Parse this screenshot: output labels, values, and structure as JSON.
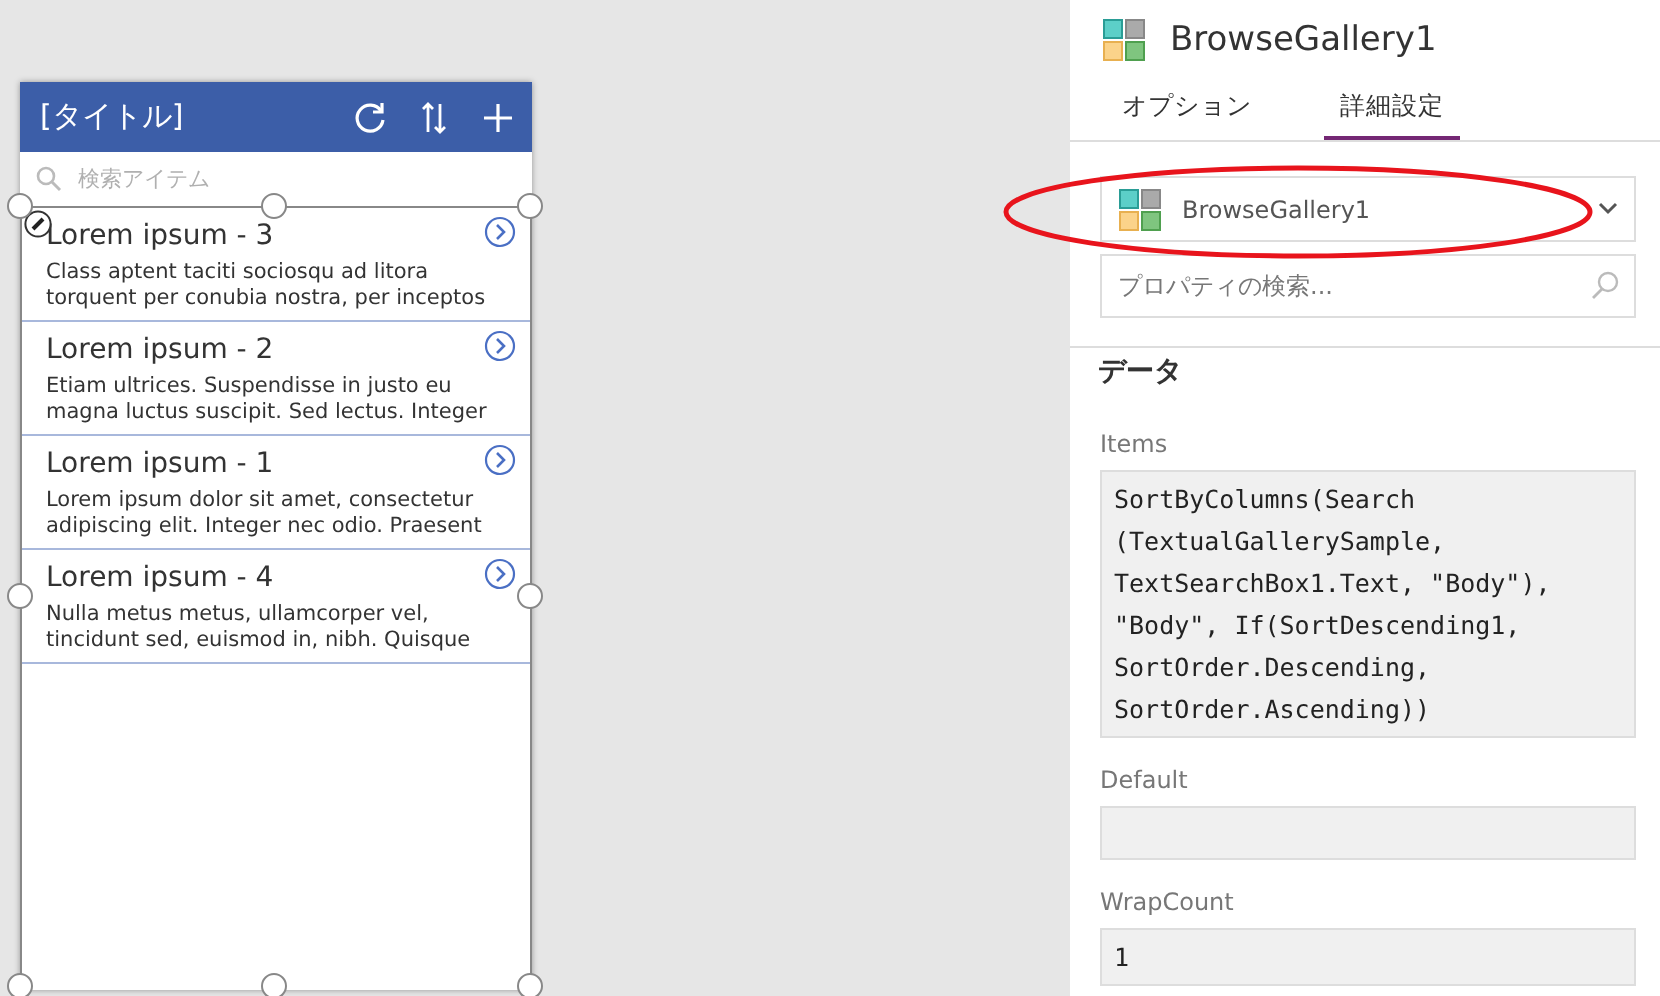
{
  "app_screen": {
    "title": "[タイトル]",
    "search": {
      "placeholder": "検索アイテム"
    },
    "items": [
      {
        "title": "Lorem ipsum - 3",
        "body": [
          "Class aptent taciti sociosqu ad litora",
          "torquent per conubia nostra, per inceptos"
        ]
      },
      {
        "title": "Lorem ipsum - 2",
        "body": [
          "Etiam ultrices. Suspendisse in justo eu",
          "magna luctus suscipit. Sed lectus. Integer"
        ]
      },
      {
        "title": "Lorem ipsum - 1",
        "body": [
          "Lorem ipsum dolor sit amet, consectetur",
          "adipiscing elit. Integer nec odio. Praesent"
        ]
      },
      {
        "title": "Lorem ipsum - 4",
        "body": [
          "Nulla metus metus, ullamcorper vel,",
          "tincidunt sed, euismod in, nibh. Quisque"
        ]
      }
    ]
  },
  "properties_panel": {
    "title": "BrowseGallery1",
    "tabs": [
      {
        "label": "オプション",
        "selected": false
      },
      {
        "label": "詳細設定",
        "selected": true
      }
    ],
    "control_select": {
      "value": "BrowseGallery1"
    },
    "property_search": {
      "placeholder": "プロパティの検索..."
    },
    "section": "データ",
    "properties": [
      {
        "name": "Items",
        "lines": [
          "SortByColumns(Search",
          "(TextualGallerySample,",
          "TextSearchBox1.Text, \"Body\"),",
          "\"Body\", If(SortDescending1,",
          "SortOrder.Descending,",
          "SortOrder.Ascending))"
        ]
      },
      {
        "name": "Default"
      },
      {
        "name": "WrapCount",
        "lines": [
          "1"
        ]
      }
    ]
  }
}
